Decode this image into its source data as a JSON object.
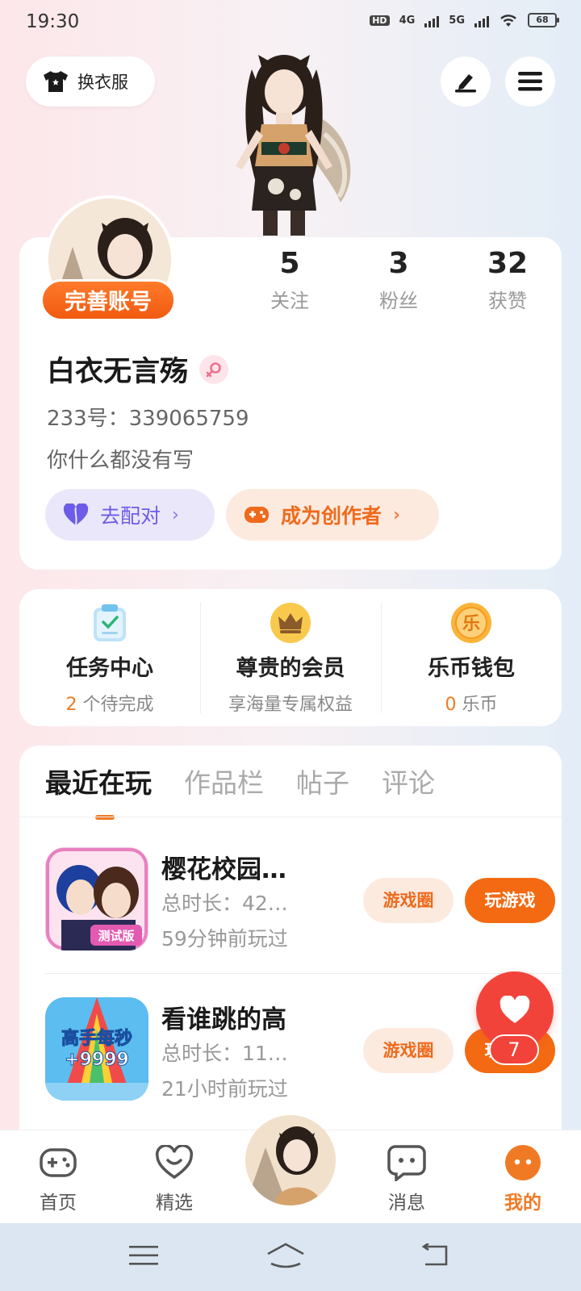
{
  "status_bar": {
    "time": "19:30",
    "network_hd": "HD",
    "net_4g": "4G",
    "net_5g": "5G",
    "battery": "68"
  },
  "header": {
    "outfit_label": "换衣服",
    "edit_icon": "pen-icon",
    "menu_icon": "hamburger-menu-icon"
  },
  "profile": {
    "complete_account": "完善账号",
    "stats": [
      {
        "value": "5",
        "label": "关注"
      },
      {
        "value": "3",
        "label": "粉丝"
      },
      {
        "value": "32",
        "label": "获赞"
      }
    ],
    "username": "白衣无言殇",
    "gender_icon": "female-icon",
    "uid_label": "233号：",
    "uid": "339065759",
    "bio": "你什么都没有写",
    "match_label": "去配对",
    "creator_label": "成为创作者"
  },
  "services": [
    {
      "title": "任务中心",
      "count": "2",
      "sub": "个待完成",
      "icon": "clipboard-icon"
    },
    {
      "title": "尊贵的会员",
      "sub": "享海量专属权益",
      "icon": "crown-icon"
    },
    {
      "title": "乐币钱包",
      "count": "0",
      "sub": "乐币",
      "icon": "coin-icon",
      "coin_char": "乐"
    }
  ],
  "tabs": [
    "最近在玩",
    "作品栏",
    "帖子",
    "评论"
  ],
  "games": [
    {
      "name": "樱花校园…",
      "duration": "总时长：42…",
      "last_played": "59分钟前玩过",
      "circle_label": "游戏圈",
      "play_label": "玩游戏",
      "icon_text": "测试版"
    },
    {
      "name": "看谁跳的高",
      "duration": "总时长：11…",
      "last_played": "21小时前玩过",
      "circle_label": "游戏圈",
      "play_label": "玩游戏",
      "icon_text_1": "高手每秒",
      "icon_text_2": "+9999"
    }
  ],
  "like_fab": {
    "count": "7"
  },
  "bottom_nav": {
    "home": "首页",
    "featured": "精选",
    "messages": "消息",
    "me": "我的"
  },
  "colors": {
    "accent": "#f07a24",
    "play_button": "#f36a12",
    "like_red": "#f2433a",
    "match_purple": "#6c5ce7"
  }
}
